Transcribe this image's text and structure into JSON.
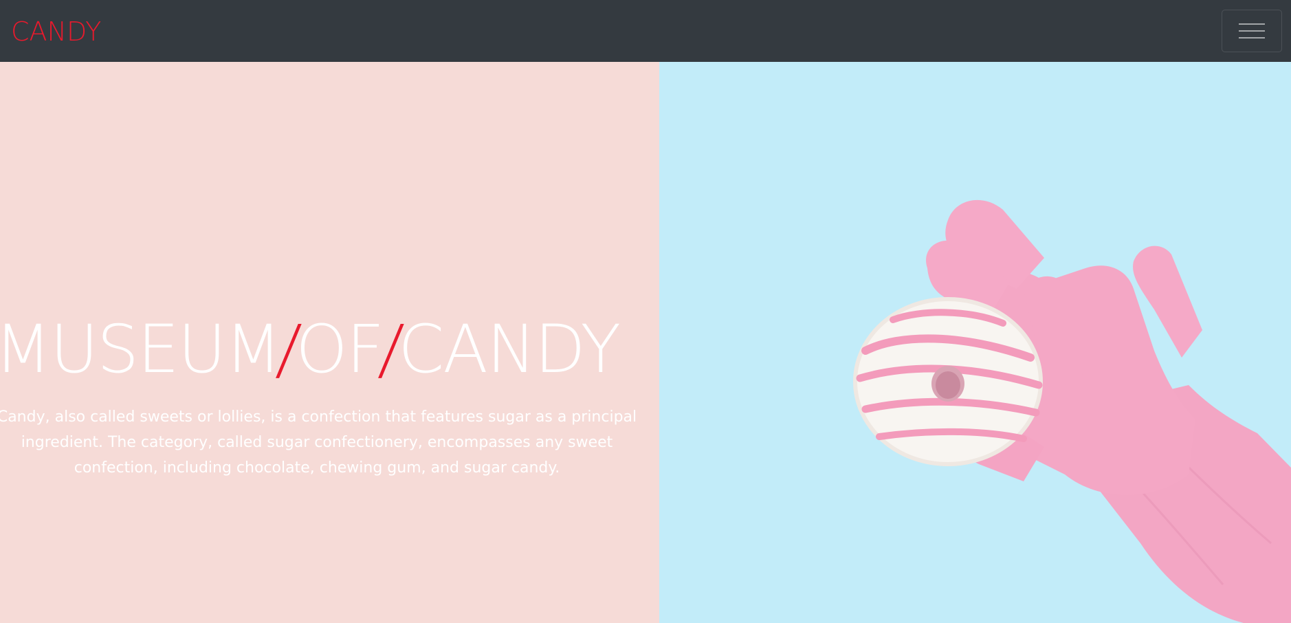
{
  "navbar": {
    "brand": "CANDY",
    "brand_color": "#e81a2d",
    "background": "#343a40",
    "toggle_icon": "hamburger-menu-icon"
  },
  "hero": {
    "title_parts": [
      "MUSEUM",
      "/",
      "OF",
      "/",
      "CANDY"
    ],
    "description": "Candy, also called sweets or lollies, is a confection that features sugar as a principal ingredient. The category, called sugar confectionery, encompasses any sweet confection, including chocolate, chewing gum, and sugar candy.",
    "left_background": "#f6dbd7",
    "right_background": "#c2ecf9",
    "accent_color": "#e81a2d",
    "image_subject": "pink-gloved hand holding a glazed donut with pink stripes"
  }
}
